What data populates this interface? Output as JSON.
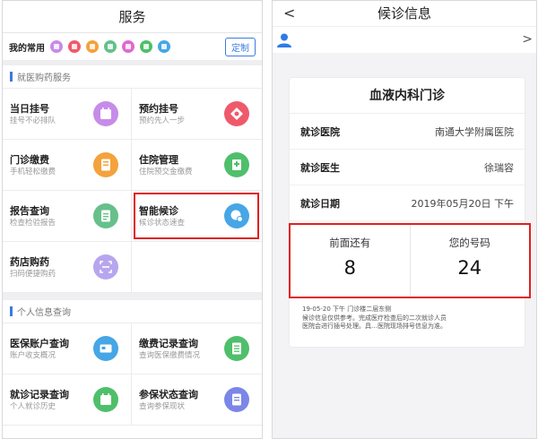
{
  "left": {
    "title": "服务",
    "favorites": {
      "label": "我的常用",
      "icon_colors": [
        "#c78be8",
        "#ef5a6b",
        "#f4a23c",
        "#66c08a",
        "#e06ad0",
        "#4fbf6b",
        "#46a6e6"
      ],
      "custom_label": "定制"
    },
    "section1": {
      "title": "就医购药服务"
    },
    "services": [
      {
        "title": "当日挂号",
        "sub": "挂号不必排队",
        "icon": "calendar-icon",
        "color": "#c78be8"
      },
      {
        "title": "预约挂号",
        "sub": "预约先人一步",
        "icon": "diamond-icon",
        "color": "#ef5a6b"
      },
      {
        "title": "门诊缴费",
        "sub": "手机轻松缴费",
        "icon": "payment-icon",
        "color": "#f4a23c"
      },
      {
        "title": "住院管理",
        "sub": "住院预交金缴费",
        "icon": "hospital-icon",
        "color": "#4fbf6b"
      },
      {
        "title": "报告查询",
        "sub": "检查检验报告",
        "icon": "report-icon",
        "color": "#66c08a"
      },
      {
        "title": "智能候诊",
        "sub": "候诊状态速查",
        "icon": "queue-icon",
        "color": "#46a6e6"
      },
      {
        "title": "药店购药",
        "sub": "扫码便捷购药",
        "icon": "scan-icon",
        "color": "#b7a6ee"
      }
    ],
    "section2": {
      "title": "个人信息查询"
    },
    "personal": [
      {
        "title": "医保账户查询",
        "sub": "账户收支概况",
        "icon": "card-icon",
        "color": "#46a6e6"
      },
      {
        "title": "缴费记录查询",
        "sub": "查询医保缴费情况",
        "icon": "receipt-icon",
        "color": "#4fbf6b"
      },
      {
        "title": "就诊记录查询",
        "sub": "个人就诊历史",
        "icon": "calendar-icon",
        "color": "#4fbf6b"
      },
      {
        "title": "参保状态查询",
        "sub": "查询参保现状",
        "icon": "document-icon",
        "color": "#7b86e8"
      }
    ]
  },
  "right": {
    "title": "候诊信息",
    "back": "<",
    "chevron": ">",
    "user_icon_color": "#2f7be5",
    "card": {
      "department": "血液内科门诊",
      "rows": [
        {
          "label": "就诊医院",
          "value": "南通大学附属医院"
        },
        {
          "label": "就诊医生",
          "value": "徐瑞容"
        },
        {
          "label": "就诊日期",
          "value": "2019年05月20日  下午"
        }
      ],
      "ahead_label": "前面还有",
      "ahead_value": "8",
      "number_label": "您的号码",
      "number_value": "24",
      "note_lines": [
        "19-05-20 下午 门诊楼二层东侧",
        "候诊信息仅供参考。完成医疗检查后的二次就诊人员",
        "医院会进行插号处理。具…医院现场排号信息为准。"
      ]
    }
  },
  "colors": {
    "highlight": "#e02020",
    "accent": "#3a7be0"
  }
}
